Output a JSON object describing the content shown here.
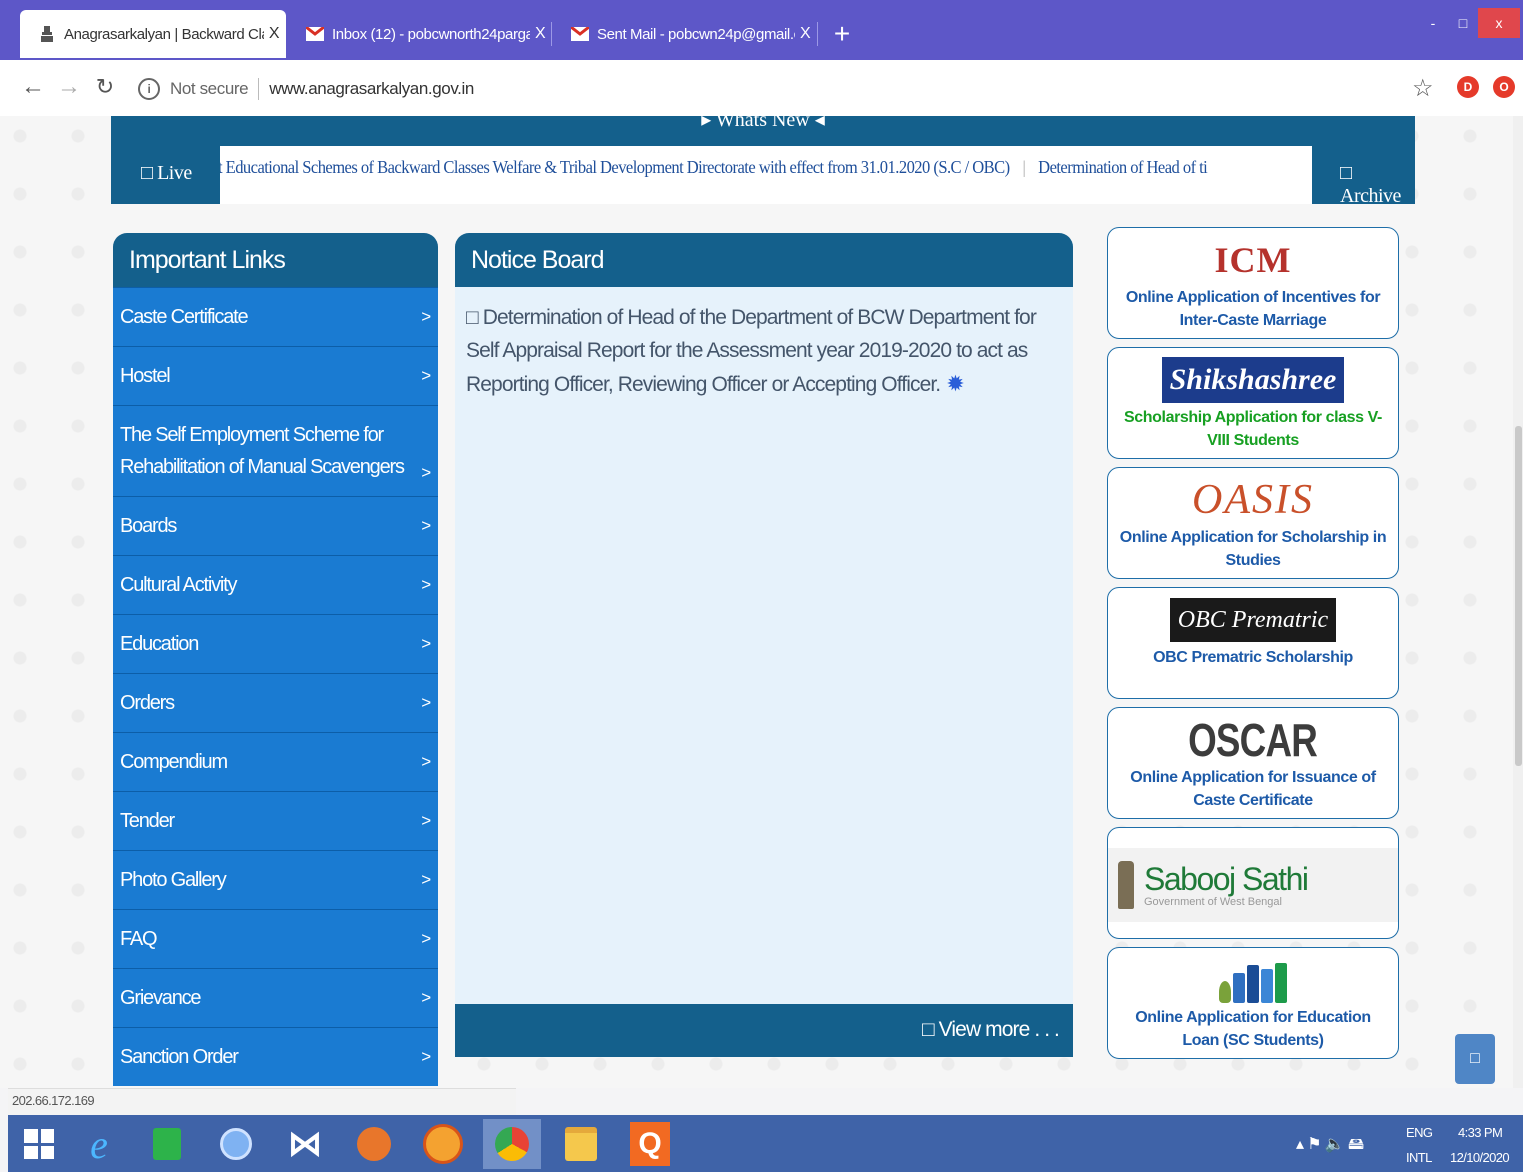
{
  "browser": {
    "tabs": [
      {
        "title": "Anagrasarkalyan | Backward Cla",
        "close": "X",
        "active": true
      },
      {
        "title": "Inbox (12) - pobcwnorth24parga",
        "close": "X",
        "active": false
      },
      {
        "title": "Sent Mail - pobcwn24p@gmail.c",
        "close": "X",
        "active": false
      }
    ],
    "new_tab": "+",
    "window_controls": {
      "minimize": "-",
      "maximize": "□",
      "close": "x"
    },
    "security_label": "Not secure",
    "url": "www.anagrasarkalyan.gov.in",
    "extensions": [
      "D",
      "O"
    ]
  },
  "page": {
    "whats_new": "Whats New",
    "ticker": {
      "live_label": "Live",
      "items": [
        "t Educational Schemes of Backward Classes Welfare & Tribal Development Directorate with effect from 31.01.2020 (S.C / OBC)",
        "Determination of Head of ti"
      ],
      "separator": "|",
      "archive_label": "Archive"
    },
    "important_links": {
      "title": "Important Links",
      "items": [
        "Caste Certificate",
        "Hostel",
        "The Self Employment Scheme for Rehabilitation of Manual Scavengers",
        "Boards",
        "Cultural Activity",
        "Education",
        "Orders",
        "Compendium",
        "Tender",
        "Photo Gallery",
        "FAQ",
        "Grievance",
        "Sanction Order"
      ],
      "chevron": ">"
    },
    "notice_board": {
      "title": "Notice Board",
      "notice": "Determination of Head of the Department of BCW Department for Self Appraisal Report for the Assessment year 2019-2020 to act as Reporting Officer, Reviewing Officer or Accepting Officer.",
      "view_more": "View more . . ."
    },
    "cards": [
      {
        "logo_text": "ICM",
        "caption": "Online Application of Incentives for Inter-Caste Marriage"
      },
      {
        "logo_text": "Shikshashree",
        "caption": "Scholarship Application for class V-VIII Students"
      },
      {
        "logo_text": "OASIS",
        "caption": "Online Application for Scholarship in Studies"
      },
      {
        "logo_text": "OBC Prematric",
        "caption": "OBC Prematric Scholarship"
      },
      {
        "logo_text": "OSCAR",
        "caption": "Online Application for Issuance of Caste Certificate"
      },
      {
        "logo_text": "Sabooj Sathi",
        "logo_subtext": "Government of West Bengal",
        "caption": ""
      },
      {
        "logo_text": "",
        "caption": "Online Application for Education Loan (SC Students)"
      }
    ]
  },
  "status_bar": "202.66.172.169",
  "taskbar": {
    "tray": {
      "lang": "ENG",
      "layout": "INTL",
      "time": "4:33 PM",
      "date": "12/10/2020"
    }
  },
  "colors": {
    "tabbar": "#5d57c8",
    "header_blue": "#14608c",
    "link_blue": "#1a7bd2",
    "notice_bg": "#e6f2fb",
    "taskbar": "#3f63a8"
  }
}
